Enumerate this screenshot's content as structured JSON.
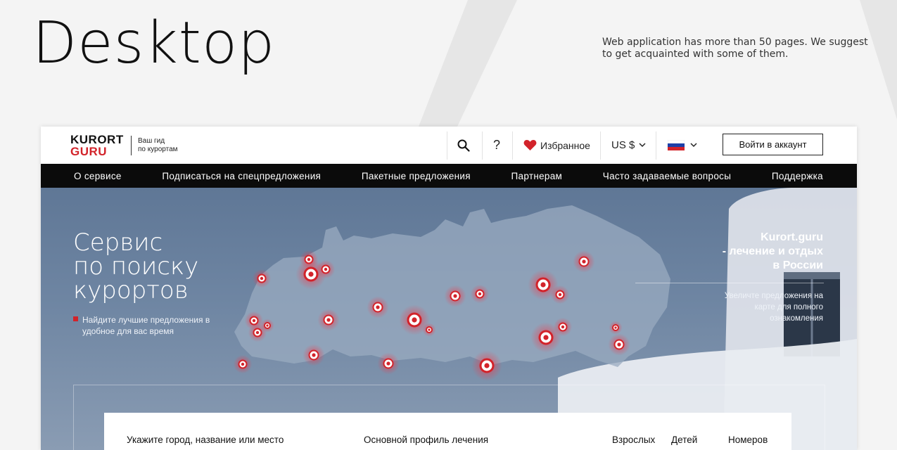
{
  "presentation": {
    "title": "Desktop",
    "description": "Web application has more than 50 pages. We suggest to get acquainted with some of them."
  },
  "header": {
    "logo_line1": "KURORT",
    "logo_line2": "GURU",
    "tagline_line1": "Ваш гид",
    "tagline_line2": "по курортам",
    "search_icon": "search-icon",
    "help_label": "?",
    "favorites_label": "Избранное",
    "currency_label": "US $",
    "language_flag": "russia-flag-icon",
    "login_label": "Войти в аккаунт"
  },
  "nav": {
    "items": [
      {
        "label": "О сервисе"
      },
      {
        "label": "Подписаться на спецпредложения"
      },
      {
        "label": "Пакетные предложения"
      },
      {
        "label": "Партнерам"
      },
      {
        "label": "Часто задаваемые вопросы"
      },
      {
        "label": "Поддержка"
      }
    ]
  },
  "hero": {
    "title_lines": [
      "Сервис",
      "по поиску",
      "курортов"
    ],
    "subtitle": "Найдите лучшие предложения в удобное для вас время",
    "side_title_lines": [
      "Kurort.guru",
      "- лечение и отдых",
      "в России"
    ],
    "side_desc": "Увеличте предложения на карте для полного ознакомления"
  },
  "search": {
    "place_label": "Укажите город, название или место",
    "profile_label": "Основной профиль лечения",
    "adults_label": "Взрослых",
    "children_label": "Детей",
    "rooms_label": "Номеров"
  },
  "colors": {
    "brand_red": "#d2232a",
    "nav_bg": "#0b0b0b"
  }
}
